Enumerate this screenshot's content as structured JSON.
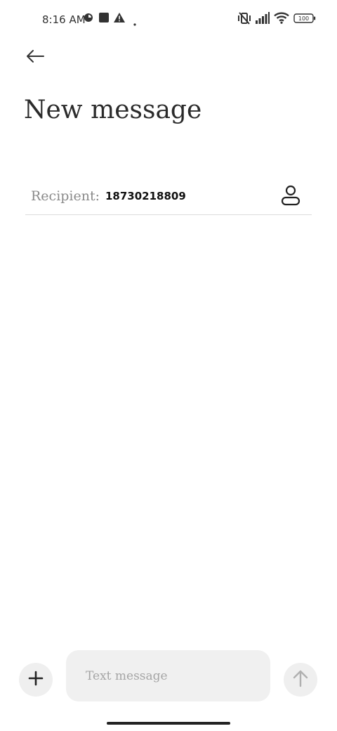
{
  "status_bar": {
    "time": "8:16 AM",
    "battery": "100",
    "icons": [
      "data-saver-icon",
      "stop-square-icon",
      "warning-icon",
      "dot-icon",
      "vibrate-off-icon",
      "signal-icon",
      "wifi-icon",
      "battery-icon"
    ]
  },
  "header": {
    "back_icon": "arrow-left-icon",
    "title": "New message"
  },
  "recipient": {
    "label": "Recipient:",
    "value": "18730218809",
    "contact_icon": "person-icon"
  },
  "composer": {
    "add_icon": "plus-icon",
    "placeholder": "Text message",
    "send_icon": "arrow-up-icon"
  }
}
